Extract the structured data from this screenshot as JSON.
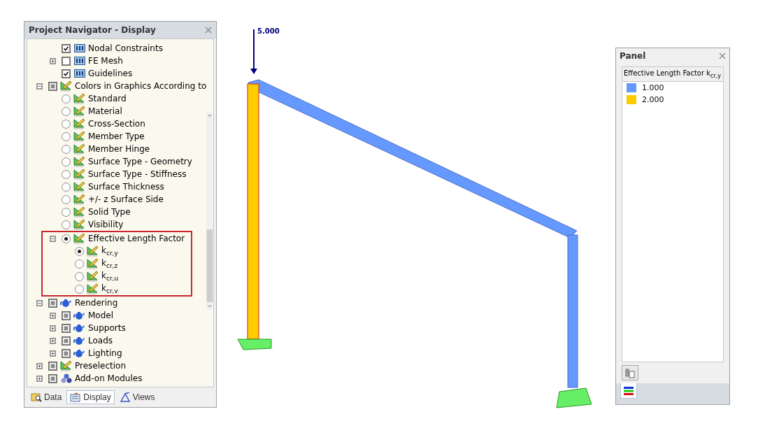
{
  "navigator": {
    "title": "Project Navigator - Display",
    "tree": {
      "partial_branch": [
        {
          "label": "Nodal Constraints",
          "kind": "option",
          "checked": true
        },
        {
          "label": "FE Mesh",
          "kind": "option",
          "checked": false,
          "expanded": false
        },
        {
          "label": "Guidelines",
          "kind": "option",
          "checked": true
        }
      ],
      "items": [
        {
          "label": "Colors in Graphics According to",
          "kind": "group",
          "partial": true,
          "expanded": true,
          "children": [
            {
              "label": "Standard",
              "kind": "choice",
              "selected": false
            },
            {
              "label": "Material",
              "kind": "choice",
              "selected": false
            },
            {
              "label": "Cross-Section",
              "kind": "choice",
              "selected": false
            },
            {
              "label": "Member Type",
              "kind": "choice",
              "selected": false
            },
            {
              "label": "Member Hinge",
              "kind": "choice",
              "selected": false
            },
            {
              "label": "Surface Type - Geometry",
              "kind": "choice",
              "selected": false
            },
            {
              "label": "Surface Type - Stiffness",
              "kind": "choice",
              "selected": false
            },
            {
              "label": "Surface Thickness",
              "kind": "choice",
              "selected": false
            },
            {
              "label": "+/- z Surface Side",
              "kind": "choice",
              "selected": false
            },
            {
              "label": "Solid Type",
              "kind": "choice",
              "selected": false
            },
            {
              "label": "Visibility",
              "kind": "choice",
              "selected": false
            },
            {
              "label": "Effective Length Factor",
              "kind": "choice",
              "selected": true,
              "expanded": true,
              "highlighted": true,
              "children": [
                {
                  "label": "k$_{cr,y}$",
                  "kind": "choice",
                  "selected": true
                },
                {
                  "label": "k$_{cr,z}$",
                  "kind": "choice",
                  "selected": false
                },
                {
                  "label": "k$_{cr,u}$",
                  "kind": "choice",
                  "selected": false
                },
                {
                  "label": "k$_{cr,v}$",
                  "kind": "choice",
                  "selected": false
                }
              ]
            }
          ]
        },
        {
          "label": "Rendering",
          "kind": "render",
          "partial": true,
          "expanded": true,
          "children": [
            {
              "label": "Model",
              "kind": "render",
              "partial": true,
              "expanded": false
            },
            {
              "label": "Supports",
              "kind": "render",
              "partial": true,
              "expanded": false
            },
            {
              "label": "Loads",
              "kind": "render",
              "partial": true,
              "expanded": false
            },
            {
              "label": "Lighting",
              "kind": "render",
              "partial": true,
              "expanded": false
            }
          ]
        },
        {
          "label": "Preselection",
          "kind": "group",
          "partial": true,
          "expanded": false
        },
        {
          "label": "Add-on Modules",
          "kind": "modules",
          "partial": true,
          "expanded": false
        }
      ]
    },
    "tabs": [
      {
        "label": "Data",
        "selected": false,
        "kind": "data"
      },
      {
        "label": "Display",
        "selected": true,
        "kind": "display"
      },
      {
        "label": "Views",
        "selected": false,
        "kind": "views"
      }
    ]
  },
  "viewport": {
    "load_label": "5.000"
  },
  "panel": {
    "title": "Panel",
    "legend_title": "Effective Length Factor k$_{cr,y}$",
    "legend": [
      {
        "label": "1.000",
        "color": "#6699ff"
      },
      {
        "label": "2.000",
        "color": "#ffcc00"
      }
    ]
  }
}
